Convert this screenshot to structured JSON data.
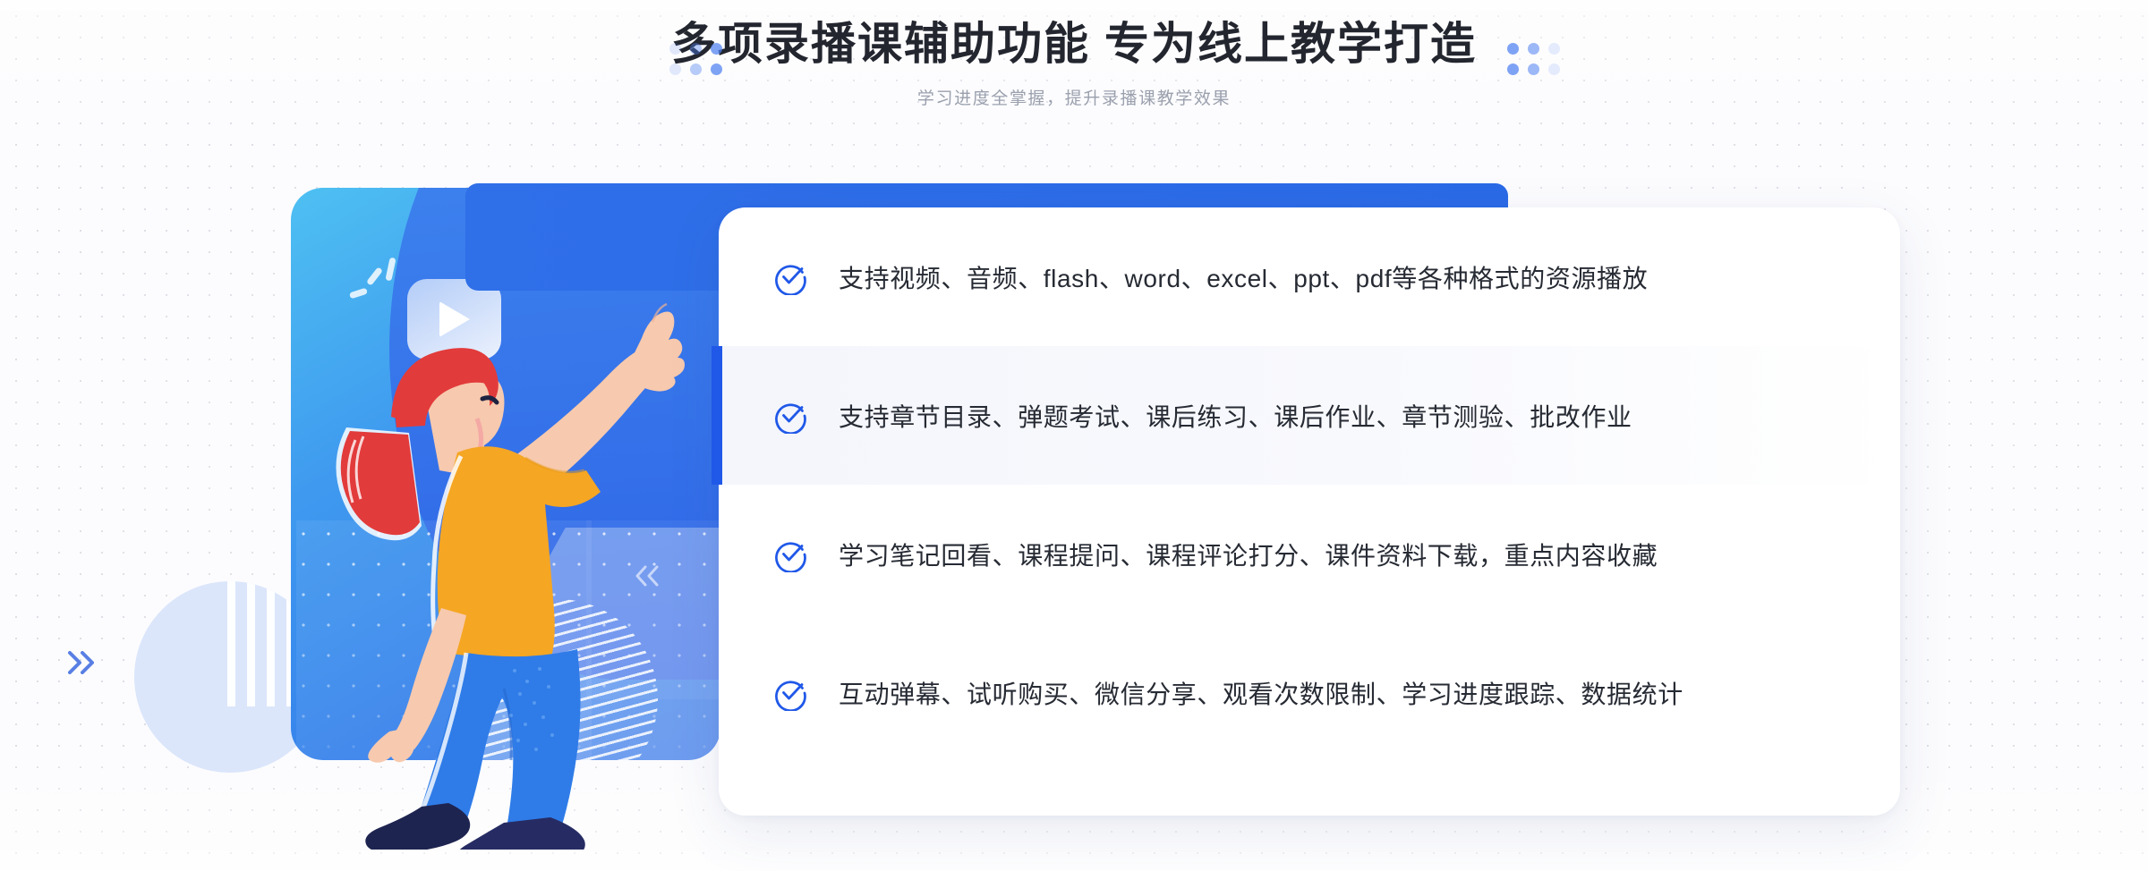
{
  "header": {
    "title": "多项录播课辅助功能 专为线上教学打造",
    "subtitle": "学习进度全掌握，提升录播课教学效果"
  },
  "colors": {
    "accent_blue": "#2058e8",
    "card_blue_start": "#4ec0f2",
    "card_blue_end": "#2f6fe8",
    "bar_blue": "#2f6fe8",
    "title_text": "#23262e",
    "subtitle_text": "#9aa0ad",
    "body_text": "#262a33",
    "page_background": "#fcfcfe",
    "highlight_row": "#f4f6fc",
    "shirt_yellow": "#f5a623",
    "hair_red": "#e23b3b",
    "jeans_blue": "#2f7ce8",
    "shoe_navy": "#1e2450",
    "skin": "#f7c5a8"
  },
  "features": [
    {
      "id": "resource-playback",
      "icon": "check-circle-icon",
      "text": "支持视频、音频、flash、word、excel、ppt、pdf等各种格式的资源播放",
      "highlighted": false
    },
    {
      "id": "chapters-exams",
      "icon": "check-circle-icon",
      "text": "支持章节目录、弹题考试、课后练习、课后作业、章节测验、批改作业",
      "highlighted": true
    },
    {
      "id": "notes-review",
      "icon": "check-circle-icon",
      "text": "学习笔记回看、课程提问、课程评论打分、课件资料下载，重点内容收藏",
      "highlighted": false
    },
    {
      "id": "interaction-stats",
      "icon": "check-circle-icon",
      "text": "互动弹幕、试听购买、微信分享、观看次数限制、学习进度跟踪、数据统计",
      "highlighted": false
    }
  ],
  "decorations": {
    "dot_cluster_left": "dot-grid-decoration",
    "dot_cluster_right": "dot-grid-decoration",
    "left_chevron": "double-chevron-right-icon",
    "card_chevron": "double-chevron-left-icon",
    "left_circle": "striped-circle-decoration",
    "play_bubble": "video-play-bubble-icon",
    "illustration": "woman-pointing-up-illustration"
  }
}
